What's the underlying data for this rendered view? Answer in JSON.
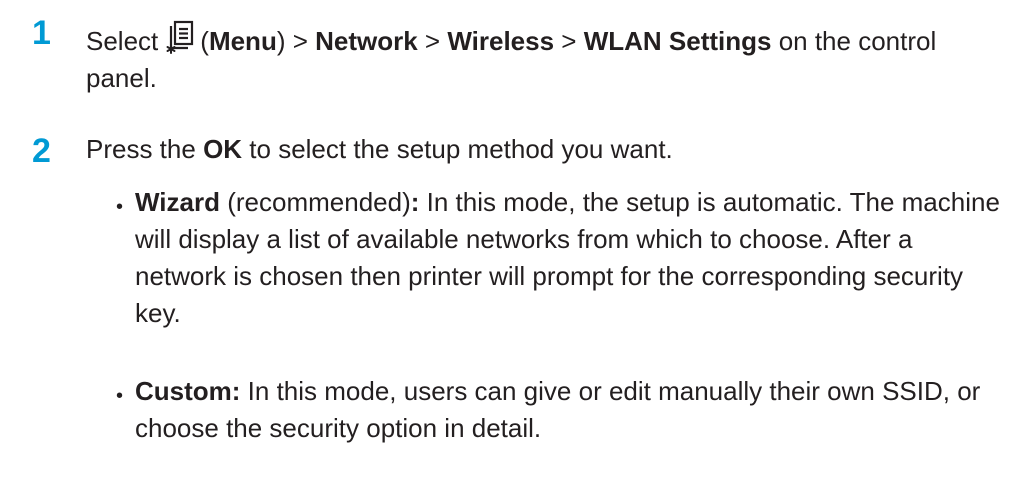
{
  "steps": [
    {
      "number": "1",
      "prefix": "Select",
      "icon": "menu-icon",
      "menu_open": "(",
      "menu_label": "Menu",
      "menu_close": ") > ",
      "network": "Network",
      "sep1": " > ",
      "wireless": "Wireless",
      "sep2": " > ",
      "wlan": "WLAN Settings",
      "suffix": " on the control panel."
    },
    {
      "number": "2",
      "prefix": "Press the ",
      "ok": "OK",
      "suffix": " to select the setup method you want."
    }
  ],
  "bullets": [
    {
      "marker": "•",
      "title": "Wizard",
      "paren": " (recommended)",
      "colon": ":",
      "text": " In this mode, the setup is automatic. The machine will display a list of available networks from which to choose. After a network is chosen then printer will prompt for the corresponding security key."
    },
    {
      "marker": "•",
      "title": "Custom:",
      "text": " In this mode, users can give or edit manually their own SSID, or choose the security option in detail."
    }
  ]
}
